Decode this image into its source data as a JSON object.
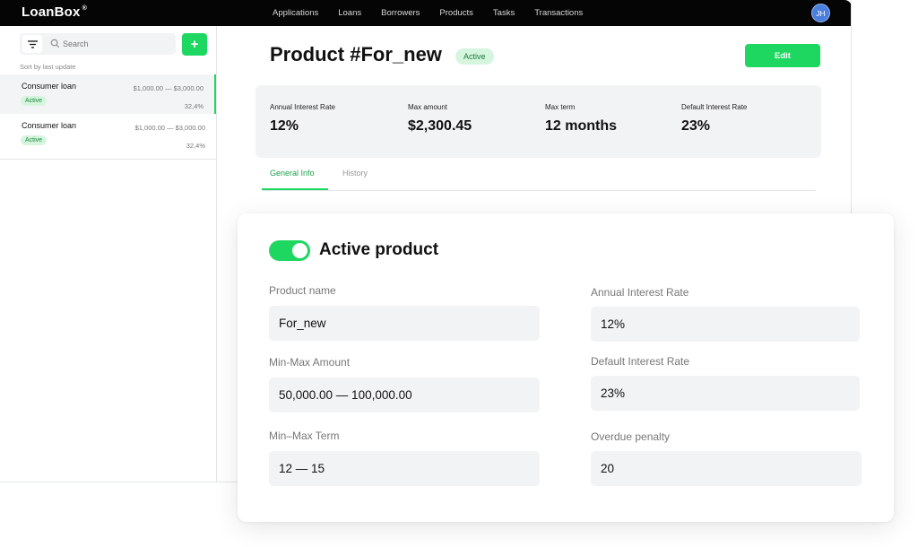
{
  "app": {
    "logo": "LoanBox",
    "logo_mark": "®",
    "avatar_initials": "JH"
  },
  "nav": {
    "items": [
      "Applications",
      "Loans",
      "Borrowers",
      "Products",
      "Tasks",
      "Transactions"
    ]
  },
  "sidebar": {
    "search_placeholder": "Search",
    "add_label": "+",
    "sort_label": "Sort by last update",
    "items": [
      {
        "title": "Consumer loan",
        "range": "$1,000.00 — $3,000.00",
        "status": "Active",
        "percent": "32,4%"
      },
      {
        "title": "Consumer loan",
        "range": "$1,000.00 — $3,000.00",
        "status": "Active",
        "percent": "32,4%"
      }
    ]
  },
  "product": {
    "title": "Product #For_new",
    "status": "Active",
    "edit_label": "Edit",
    "stats": [
      {
        "label": "Annual Interest Rate",
        "value": "12%"
      },
      {
        "label": "Max amount",
        "value": "$2,300.45"
      },
      {
        "label": "Max term",
        "value": "12 months"
      },
      {
        "label": "Default Interest Rate",
        "value": "23%"
      }
    ],
    "tabs": [
      "General Info",
      "History"
    ]
  },
  "card": {
    "toggle_on": true,
    "title": "Active product",
    "fields": {
      "product_name": {
        "label": "Product name",
        "value": "For_new"
      },
      "min_max_amount": {
        "label": "Min-Max Amount",
        "value": "50,000.00 — 100,000.00"
      },
      "min_max_term": {
        "label": "Min–Max Term",
        "value": "12 — 15"
      },
      "annual_interest_rate": {
        "label": "Annual Interest Rate",
        "value": "12%"
      },
      "default_interest_rate": {
        "label": "Default Interest Rate",
        "value": "23%"
      },
      "overdue_penalty": {
        "label": "Overdue penalty",
        "value": "20"
      }
    }
  },
  "colors": {
    "accent": "#1ed760",
    "topbar": "#050505",
    "avatar": "#4a7fe0"
  }
}
